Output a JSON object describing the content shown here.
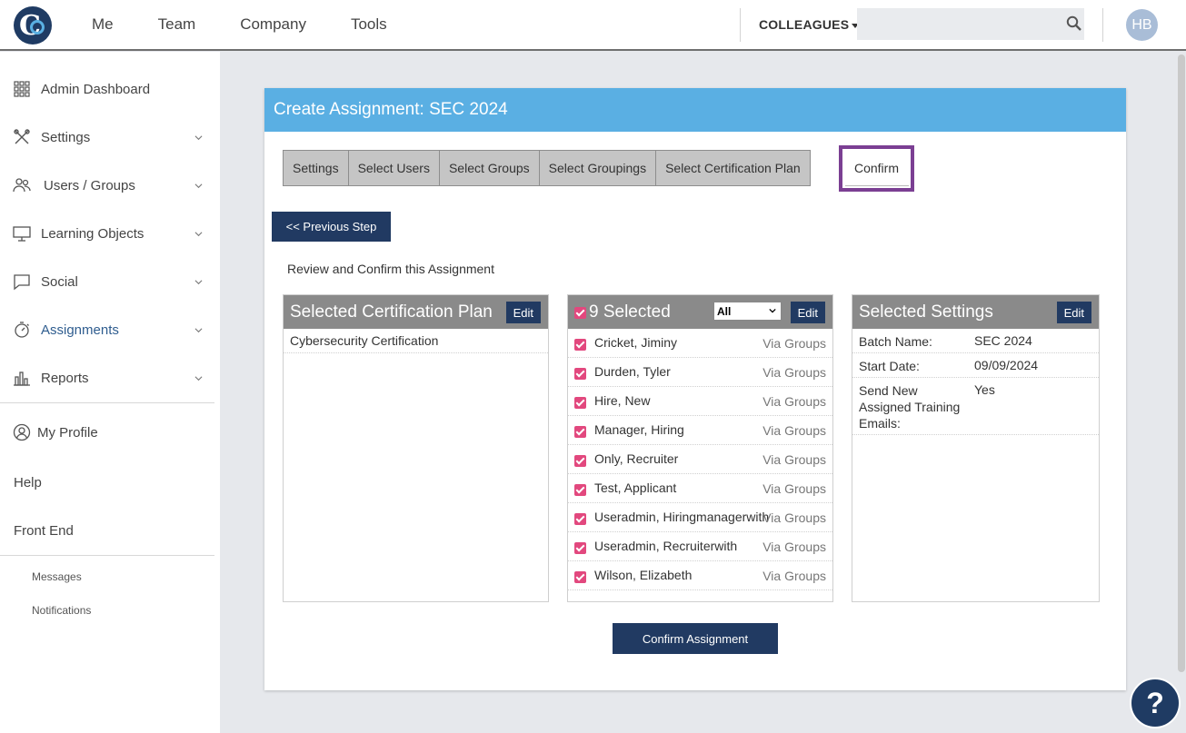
{
  "topbar": {
    "logo_text": "Co",
    "nav": [
      "Me",
      "Team",
      "Company",
      "Tools"
    ],
    "colleagues_label": "COLLEAGUES",
    "search_placeholder": "",
    "avatar_initials": "HB"
  },
  "sidebar": {
    "items": [
      {
        "label": "Admin Dashboard",
        "icon": "grid-icon",
        "has_chevron": false
      },
      {
        "label": "Settings",
        "icon": "tools-icon",
        "has_chevron": true
      },
      {
        "label": "Users / Groups",
        "icon": "users-icon",
        "has_chevron": true
      },
      {
        "label": "Learning Objects",
        "icon": "monitor-icon",
        "has_chevron": true
      },
      {
        "label": "Social",
        "icon": "chat-icon",
        "has_chevron": true
      },
      {
        "label": "Assignments",
        "icon": "stopwatch-icon",
        "has_chevron": true,
        "active": true
      },
      {
        "label": "Reports",
        "icon": "bar-chart-icon",
        "has_chevron": true
      }
    ],
    "my_profile": "My Profile",
    "help": "Help",
    "front_end": "Front End",
    "messages": "Messages",
    "notifications": "Notifications"
  },
  "card": {
    "title": "Create Assignment: SEC 2024",
    "tabs": [
      "Settings",
      "Select Users",
      "Select Groups",
      "Select Groupings",
      "Select Certification Plan"
    ],
    "active_tab": "Confirm",
    "prev_button": "<< Previous Step",
    "review_text": "Review and Confirm this Assignment",
    "confirm_button": "Confirm Assignment"
  },
  "cert_panel": {
    "title": "Selected Certification Plan",
    "edit": "Edit",
    "items": [
      "Cybersecurity Certification"
    ]
  },
  "users_panel": {
    "title": "9 Selected",
    "filter": "All",
    "edit": "Edit",
    "users": [
      {
        "name": "Cricket, Jiminy",
        "via": "Via Groups"
      },
      {
        "name": "Durden, Tyler",
        "via": "Via Groups"
      },
      {
        "name": "Hire, New",
        "via": "Via Groups"
      },
      {
        "name": "Manager, Hiring",
        "via": "Via Groups"
      },
      {
        "name": "Only, Recruiter",
        "via": "Via Groups"
      },
      {
        "name": "Test, Applicant",
        "via": "Via Groups"
      },
      {
        "name": "Useradmin, Hiringmanagerwith",
        "via": "Via Groups"
      },
      {
        "name": "Useradmin, Recruiterwith",
        "via": "Via Groups"
      },
      {
        "name": "Wilson, Elizabeth",
        "via": "Via Groups"
      }
    ]
  },
  "settings_panel": {
    "title": "Selected Settings",
    "edit": "Edit",
    "rows": [
      {
        "key": "Batch Name:",
        "value": "SEC 2024"
      },
      {
        "key": "Start Date:",
        "value": "09/09/2024"
      },
      {
        "key": "Send New Assigned Training Emails:",
        "value": "Yes"
      }
    ]
  },
  "help_button": "?",
  "colors": {
    "header_blue": "#5aafe3",
    "navy": "#213a62",
    "check_pink": "#e2487e",
    "highlight_purple": "#7b3f93"
  }
}
